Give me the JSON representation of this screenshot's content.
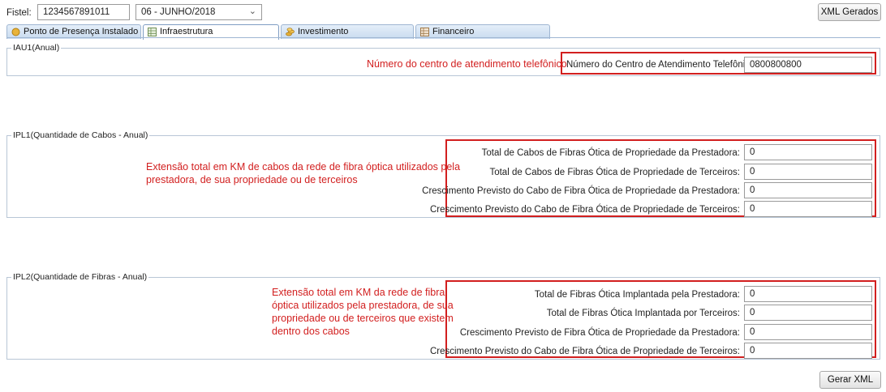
{
  "header": {
    "fistel_label": "Fistel:",
    "fistel_value": "1234567891011",
    "period_value": "06 - JUNHO/2018",
    "xml_gerados_label": "XML Gerados"
  },
  "tabs": [
    {
      "label": "Ponto de Presença Instalado",
      "icon": "coin-icon"
    },
    {
      "label": "Infraestrutura",
      "icon": "grid-icon",
      "active": true
    },
    {
      "label": "Investimento",
      "icon": "coins-stack-icon"
    },
    {
      "label": "Financeiro",
      "icon": "grid-icon"
    }
  ],
  "iau1": {
    "legend": "IAU1(Anual)",
    "annotation": "Número do centro de atendimento telefônico",
    "field_label": "Número do Centro de Atendimento Telefônico:",
    "field_value": "0800800800"
  },
  "ipl1": {
    "legend": "IPL1(Quantidade de Cabos - Anual)",
    "annotation_lines": [
      "Extensão total em KM de cabos da rede de fibra óptica utilizados pela",
      "prestadora, de sua propriedade ou de terceiros"
    ],
    "fields": [
      {
        "label": "Total de Cabos de Fibras Ótica de Propriedade da Prestadora:",
        "value": "0"
      },
      {
        "label": "Total de Cabos de Fibras Ótica de Propriedade de Terceiros:",
        "value": "0"
      },
      {
        "label": "Crescimento Previsto do Cabo de Fibra Ótica de Propriedade da Prestadora:",
        "value": "0"
      },
      {
        "label": "Crescimento Previsto do Cabo de Fibra Ótica de Propriedade de Terceiros:",
        "value": "0"
      }
    ]
  },
  "ipl2": {
    "legend": "IPL2(Quantidade de Fibras - Anual)",
    "annotation_lines": [
      "Extensão total em KM da rede de fibra",
      "óptica utilizados pela prestadora, de sua",
      "propriedade ou de terceiros que existem",
      "dentro dos cabos"
    ],
    "fields": [
      {
        "label": "Total de Fibras Ótica Implantada pela Prestadora:",
        "value": "0"
      },
      {
        "label": "Total de Fibras Ótica Implantada por Terceiros:",
        "value": "0"
      },
      {
        "label": "Crescimento Previsto de Fibra Ótica de Propriedade da Prestadora:",
        "value": "0"
      },
      {
        "label": "Crescimento Previsto do Cabo de Fibra Ótica de Propriedade de Terceiros:",
        "value": "0"
      }
    ]
  },
  "footer": {
    "gerar_xml_label": "Gerar XML"
  },
  "colors": {
    "annotation_red": "#d21f1f",
    "tab_border": "#9fb6d2"
  }
}
